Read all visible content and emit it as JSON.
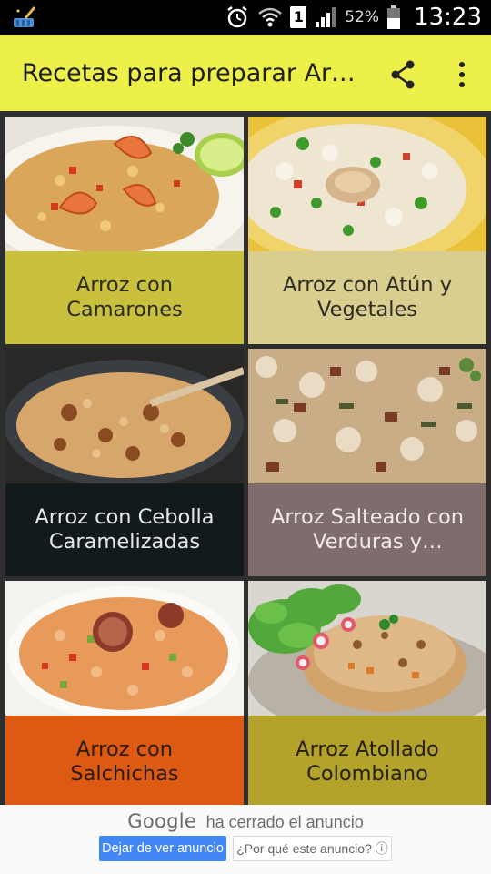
{
  "status_bar": {
    "battery_percent": "52%",
    "time": "13:23",
    "sim_label": "1",
    "icons": [
      "broom-icon",
      "alarm-icon",
      "wifi-icon",
      "sim-icon",
      "signal-icon",
      "battery-icon"
    ]
  },
  "app_bar": {
    "title": "Recetas para preparar Arroz",
    "share_icon": "share-icon",
    "more_icon": "more-vert-icon"
  },
  "recipes": [
    {
      "title": "Arroz con Camarones",
      "label_color": "#c9c13e",
      "text_color": "#2b2b20"
    },
    {
      "title": "Arroz con Atún y Vegetales",
      "label_color": "#d9cd8f",
      "text_color": "#2f2c22"
    },
    {
      "title": "Arroz con Cebolla Caramelizadas",
      "label_color": "#121a1b",
      "text_color": "#e8e8e8"
    },
    {
      "title": "Arroz Salteado con Verduras y Champiñones",
      "label_color": "#7f6c6c",
      "text_color": "#f0eaea"
    },
    {
      "title": "Arroz con Salchichas",
      "label_color": "#dd5a12",
      "text_color": "#2a1a10"
    },
    {
      "title": "Arroz Atollado Colombiano",
      "label_color": "#b3a32a",
      "text_color": "#25200c"
    }
  ],
  "ad": {
    "brand": "Google",
    "closed_text": "ha cerrado el anuncio",
    "stop_button": "Dejar de ver anuncio",
    "why_button": "¿Por qué este anuncio? ⓘ"
  }
}
